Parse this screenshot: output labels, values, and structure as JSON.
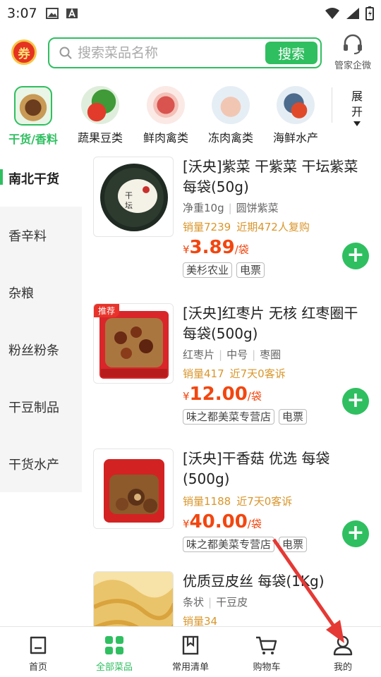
{
  "status": {
    "time": "3:07"
  },
  "header": {
    "coupon_label": "券",
    "search_placeholder": "搜索菜品名称",
    "search_button": "搜索",
    "steward_label": "管家企微"
  },
  "categories": [
    {
      "label": "干货/香料",
      "active": true
    },
    {
      "label": "蔬果豆类",
      "active": false
    },
    {
      "label": "鲜肉禽类",
      "active": false
    },
    {
      "label": "冻肉禽类",
      "active": false
    },
    {
      "label": "海鲜水产",
      "active": false
    }
  ],
  "expand_label_1": "展",
  "expand_label_2": "开",
  "sidebar": [
    {
      "label": "南北干货",
      "active": true
    },
    {
      "label": "香辛料",
      "active": false
    },
    {
      "label": "杂粮",
      "active": false
    },
    {
      "label": "粉丝粉条",
      "active": false
    },
    {
      "label": "干豆制品",
      "active": false
    },
    {
      "label": "干货水产",
      "active": false
    }
  ],
  "products": [
    {
      "title": "[沃央]紫菜 干紫菜 干坛紫菜 每袋(50g)",
      "specs": [
        "净重10g",
        "圆饼紫菜"
      ],
      "sales": [
        "销量7239",
        "近期472人复购"
      ],
      "price_symbol": "¥",
      "price": "3.89",
      "unit": "/袋",
      "tags": [
        "美杉农业",
        "电票"
      ]
    },
    {
      "title": "[沃央]红枣片 无核 红枣圈干 每袋(500g)",
      "badge": "推荐",
      "specs": [
        "红枣片",
        "中号",
        "枣圈"
      ],
      "sales": [
        "销量417",
        "近7天0客诉"
      ],
      "price_symbol": "¥",
      "price": "12.00",
      "unit": "/袋",
      "tags": [
        "味之都美菜专营店",
        "电票"
      ]
    },
    {
      "title": "[沃央]干香菇 优选 每袋(500g)",
      "specs": [],
      "sales": [
        "销量1188",
        "近7天0客诉"
      ],
      "price_symbol": "¥",
      "price": "40.00",
      "unit": "/袋",
      "tags": [
        "味之都美菜专营店",
        "电票"
      ]
    },
    {
      "title": "优质豆皮丝 每袋(1Kg)",
      "specs": [
        "条状",
        "干豆皮"
      ],
      "sales": [
        "销量34"
      ]
    }
  ],
  "bottom_nav": [
    {
      "label": "首页",
      "icon": "home-icon",
      "active": false
    },
    {
      "label": "全部菜品",
      "icon": "grid-icon",
      "active": true
    },
    {
      "label": "常用清单",
      "icon": "bookmark-icon",
      "active": false
    },
    {
      "label": "购物车",
      "icon": "cart-icon",
      "active": false
    },
    {
      "label": "我的",
      "icon": "user-icon",
      "active": false
    }
  ],
  "colors": {
    "accent": "#2fbf60",
    "price": "#f2460f",
    "sales": "#d9962b",
    "annotation_arrow": "#e53935"
  }
}
